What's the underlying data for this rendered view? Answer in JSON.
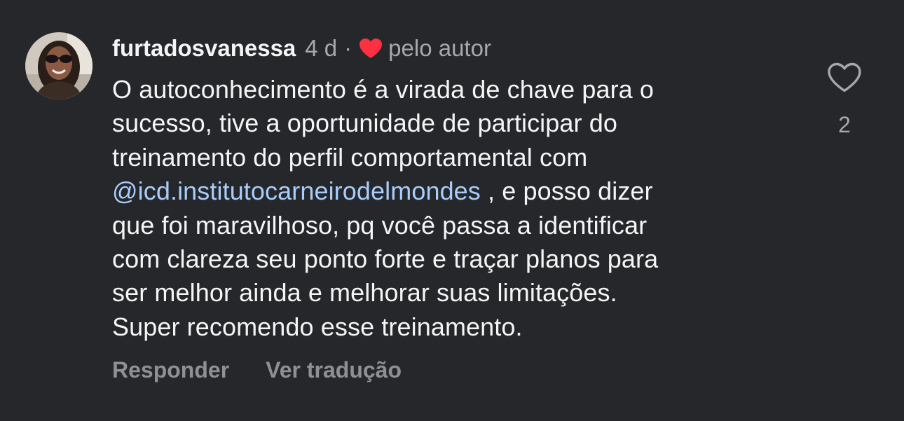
{
  "comment": {
    "username": "furtadosvanessa",
    "time": "4 d",
    "separator": "·",
    "author_like_label": "pelo autor",
    "avatar_icon": "user-avatar-photo",
    "text_lines": [
      "O autoconhecimento é a virada de chave para o",
      "sucesso, tive a oportunidade de participar do",
      "treinamento do perfil comportamental com"
    ],
    "mention": "@icd.institutocarneirodelmondes",
    "mention_suffix": " , e posso dizer",
    "text_lines_after": [
      "que foi maravilhoso, pq você passa a identificar",
      "com clareza seu ponto forte e traçar planos para",
      "ser melhor ainda e melhorar suas limitações.",
      "Super recomendo esse treinamento."
    ],
    "like_count": "2",
    "like_icon": "heart-outline-icon",
    "author_heart_icon": "heart-filled-icon",
    "author_heart_color": "#ff3040"
  },
  "actions": {
    "reply_label": "Responder",
    "translate_label": "Ver tradução"
  },
  "colors": {
    "background": "#25272b",
    "primary_text": "#f5f5f5",
    "secondary_text": "#a8a8a8",
    "mention": "#a9cdfa",
    "action_text": "#8e9096"
  }
}
